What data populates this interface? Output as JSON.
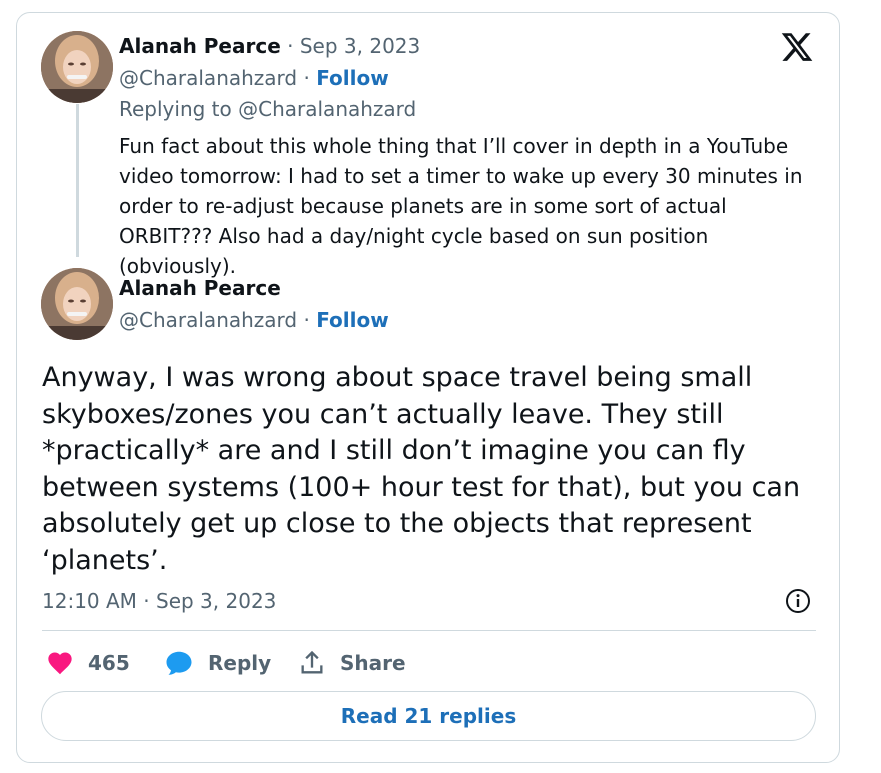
{
  "colors": {
    "link": "#1d6fb8",
    "secondary": "#536471",
    "like": "#f91880",
    "reply_icon": "#1d9bf0",
    "border": "#cfd9de"
  },
  "brand_logo": "x-logo-icon",
  "parent_tweet": {
    "author_name": "Alanah Pearce",
    "date": "Sep 3, 2023",
    "handle": "@Charalanahzard",
    "follow_label": "Follow",
    "replying_to_label": "Replying to",
    "replying_to_handle": "@Charalanahzard",
    "text": "Fun fact about this whole thing that I’ll cover in depth in a YouTube video tomorrow: I had to set a timer to wake up every 30 minutes in order to re-adjust because planets are in some sort of actual ORBIT??? Also had a day/night cycle based on sun position (obviously)."
  },
  "main_tweet": {
    "author_name": "Alanah Pearce",
    "handle": "@Charalanahzard",
    "follow_label": "Follow",
    "text": "Anyway, I was wrong about space travel being small skyboxes/zones you can’t actually leave. They still *practically* are and I still don’t imagine you can fly between systems (100+ hour test for that), but you can absolutely get up close to the objects that represent ‘planets’.",
    "timestamp": "12:10 AM · Sep 3, 2023",
    "likes": "465",
    "reply_label": "Reply",
    "share_label": "Share",
    "read_replies_label": "Read 21 replies"
  }
}
